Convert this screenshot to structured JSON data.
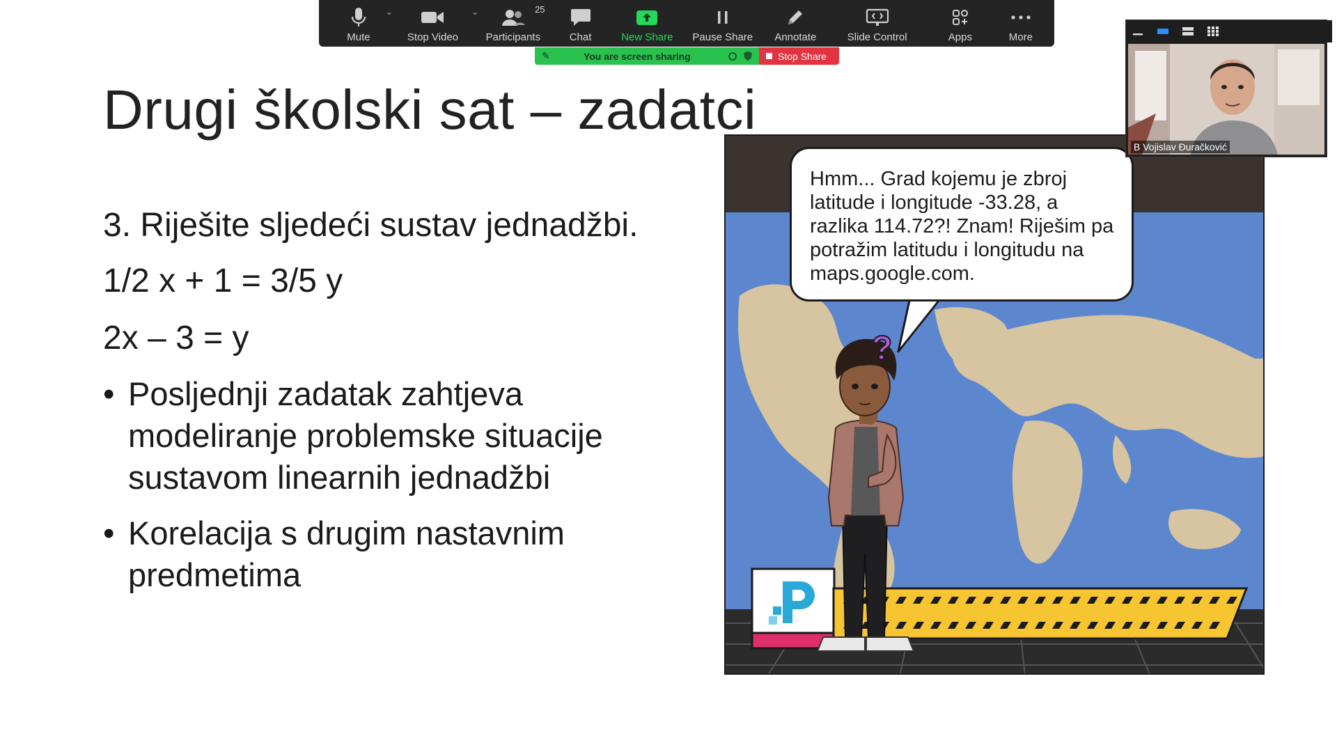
{
  "toolbar": {
    "buttons": [
      {
        "label": "Mute",
        "icon": "microphone-icon"
      },
      {
        "label": "Stop Video",
        "icon": "video-camera-icon"
      },
      {
        "label": "Participants",
        "icon": "participants-icon",
        "badge": "25"
      },
      {
        "label": "Chat",
        "icon": "chat-icon"
      },
      {
        "label": "New Share",
        "icon": "share-screen-icon"
      },
      {
        "label": "Pause Share",
        "icon": "pause-icon"
      },
      {
        "label": "Annotate",
        "icon": "pencil-icon"
      },
      {
        "label": "Slide Control",
        "icon": "slide-control-icon"
      },
      {
        "label": "Apps",
        "icon": "apps-icon"
      },
      {
        "label": "More",
        "icon": "more-icon"
      }
    ],
    "accent_green": "#23d959"
  },
  "share_banner": {
    "message": "You are screen sharing",
    "stop_label": "Stop Share",
    "green": "#2ac24f",
    "red": "#e33340"
  },
  "slide": {
    "title": "Drugi školski sat – zadatci",
    "task_heading": "3. Riješite sljedeći sustav jednadžbi.",
    "equation_1": "1/2 x + 1 = 3/5 y",
    "equation_2": "2x – 3 = y",
    "bullets": [
      "Posljednji zadatak zahtjeva modeliranje problemske situacije sustavom linearnih jednadžbi",
      "Korelacija s drugim nastavnim predmetima"
    ]
  },
  "comic": {
    "speech": "Hmm... Grad kojemu je zbroj latitude i longitude -33.28, a razlika 114.72?! Znam! Riješim pa potražim latitudu i longitudu na maps.google.com.",
    "question_mark": "?",
    "ocean_color": "#5c87cf",
    "land_color": "#d7c4a1",
    "warning_color": "#f7c531"
  },
  "video_tile": {
    "participant_name": "B Vojislav Đuračković"
  }
}
